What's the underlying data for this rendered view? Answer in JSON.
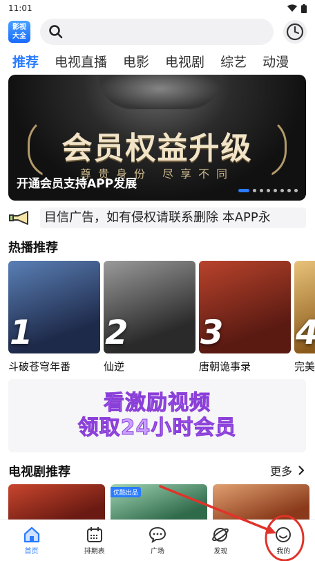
{
  "status": {
    "time": "11:01"
  },
  "app": {
    "logo_line1": "影视",
    "logo_line2": "大全"
  },
  "search": {
    "placeholder": ""
  },
  "tabs": [
    {
      "label": "推荐",
      "active": true
    },
    {
      "label": "电视直播"
    },
    {
      "label": "电影"
    },
    {
      "label": "电视剧"
    },
    {
      "label": "综艺"
    },
    {
      "label": "动漫"
    }
  ],
  "banner": {
    "headline": "会员权益升级",
    "subline": "尊贵身份 尽享不同",
    "caption": "开通会员支持APP发展",
    "dot_count": 8,
    "active_dot": 0
  },
  "notice": {
    "text": "目信广告，如有侵权请联系删除 本APP永"
  },
  "hot": {
    "title": "热播推荐",
    "items": [
      {
        "rank": "1",
        "title": "斗破苍穹年番",
        "color1": "#1e2a4a",
        "color2": "#5a7fb5"
      },
      {
        "rank": "2",
        "title": "仙逆",
        "color1": "#2a2a2a",
        "color2": "#9a9a9a"
      },
      {
        "rank": "3",
        "title": "唐朝诡事录",
        "color1": "#5a1a12",
        "color2": "#b8432c"
      },
      {
        "rank": "4",
        "title": "完美",
        "color1": "#8a5a1a",
        "color2": "#e8c27a"
      }
    ]
  },
  "promo": {
    "line1": "看激励视频",
    "line2": "领取24小时会员"
  },
  "drama": {
    "title": "电视剧推荐",
    "more_label": "更多",
    "items": [
      {
        "badge": "",
        "color1": "#6a1a12",
        "color2": "#c8462e"
      },
      {
        "badge": "优酷出品",
        "color1": "#2f6a4a",
        "color2": "#9fd3b3"
      },
      {
        "badge": "",
        "color1": "#8a3a1a",
        "color2": "#e0a070"
      }
    ]
  },
  "nav": [
    {
      "label": "首页",
      "icon": "home-icon",
      "active": true
    },
    {
      "label": "排期表",
      "icon": "calendar-icon"
    },
    {
      "label": "广场",
      "icon": "chat-icon"
    },
    {
      "label": "发现",
      "icon": "planet-icon"
    },
    {
      "label": "我的",
      "icon": "smile-icon"
    }
  ],
  "colors": {
    "accent": "#2a7bff",
    "annotation": "#e0332a"
  }
}
